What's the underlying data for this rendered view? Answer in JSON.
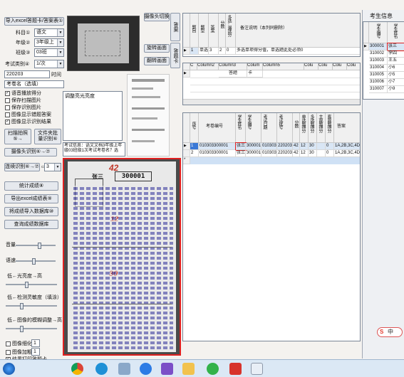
{
  "left_panel": {
    "import_button": "导入excel答题卡/答案表①",
    "subject_label": "科目①",
    "subject_value": "语文",
    "grade_label": "年级②",
    "grade_value": "3年级上",
    "class_label": "班级③",
    "class_value": "03班",
    "exam_type_label": "考试类别④",
    "exam_type_value": "1/次",
    "exam_date_value": "220203",
    "time_label": "时间",
    "exam_name_value": "考卷名（选填）",
    "checkboxes": [
      {
        "label": "语音播放得分",
        "checked": true
      },
      {
        "label": "保存扫描图片",
        "checked": false
      },
      {
        "label": "保存识别图片",
        "checked": false
      },
      {
        "label": "图像显示错题答案",
        "checked": false
      },
      {
        "label": "图像显示识别结果",
        "checked": true
      }
    ],
    "scan_button": "扫描拍照⑤→",
    "file_button": "文件夹批量识别⑥",
    "camera_button": "摄像头识别⑥→⑦",
    "continuous_button": "连续识别⑥→⑦",
    "continuous_value": "3",
    "stats_button": "统计成绩⑧",
    "export_button": "导出excel成绩表⑨",
    "import_db_button": "将成绩导入数据库⑩",
    "query_db_button": "查询成绩数据库",
    "volume_label": "音量",
    "volume_value": 0.6,
    "speed_label": "语速",
    "speed_value": 0.45,
    "light_label": "低←光亮度→高",
    "light_value": 0.4,
    "sensitivity_label": "低←检测灵敏度（填涂）→高",
    "sensitivity_value": 0.3,
    "blur_label": "低←图像的模糊调整→高",
    "blur_value": 0.3,
    "thin_label": "图像细化",
    "thin_value": "1",
    "bold_label": "图像加粗",
    "bold_value": "1",
    "last_checkbox": "结果打印答题卡"
  },
  "center_panel": {
    "camera_switch_button": "摄像头切换",
    "rotate_button": "旋转画面",
    "flip_button": "翻转画面",
    "notes_text": "调整亮光亮度",
    "info_text": "考试信息：语文文档3年级上年级03班级1次考试考卷名？选",
    "score_marks": [
      "42",
      "12",
      "30"
    ],
    "sheet_number": "300001",
    "name_mark": "张三"
  },
  "answer_tab": "答案",
  "score_tab": "答题卡",
  "answer_table": {
    "headers": [
      "题目",
      "题型",
      "答案",
      "分数",
      "多选-漏选分",
      "备注说明（本列同删除）"
    ],
    "rows": [
      [
        "1",
        "单选题",
        "3",
        "2",
        "0",
        "多选单项得分值，单选题此处必须0"
      ]
    ]
  },
  "sheet_table": {
    "headers": [
      "C",
      "Column2",
      "Column3",
      "Colum",
      "Column5",
      "Colu",
      "Colu",
      "Colu",
      "Colu"
    ],
    "rows": [
      [
        "",
        "",
        "答题",
        "卡",
        "",
        "",
        "",
        "",
        ""
      ]
    ]
  },
  "results_table": {
    "headers": [
      "序号",
      "考卷编号",
      "学生姓名",
      "学生编号",
      "考试日期",
      "考试批号",
      "分数",
      "单选题得分",
      "多选题得分",
      "主观题得分",
      "客观题得分",
      "答案"
    ],
    "rows": [
      [
        "1",
        "010303300001",
        "张三",
        "300001",
        "010303",
        "220203",
        "42",
        "12",
        "30",
        "",
        "0",
        "1A,2B,3C,4D,5"
      ],
      [
        "2",
        "010303300001",
        "张三",
        "300001",
        "010303",
        "220203",
        "42",
        "12",
        "30",
        "",
        "0",
        "1A,2B,3C,4D,5"
      ]
    ]
  },
  "students": {
    "title": "考生信息",
    "headers": [
      "学生编号",
      "学生姓名"
    ],
    "rows": [
      [
        "300001",
        "张三"
      ],
      [
        "310002",
        "李四"
      ],
      [
        "310003",
        "王五"
      ],
      [
        "310004",
        "小6"
      ],
      [
        "310005",
        "小5"
      ],
      [
        "310006",
        "小7"
      ],
      [
        "310007",
        "小9"
      ]
    ]
  },
  "ime": {
    "logo": "S",
    "mode": "中"
  },
  "taskbar": {
    "icons": [
      "windows-start-icon",
      "chrome-icon",
      "edge-icon",
      "app-icon",
      "sogou-icon",
      "visual-studio-icon",
      "folder-icon",
      "wechat-icon",
      "wps-icon",
      "answer-sheet-app-icon"
    ]
  }
}
